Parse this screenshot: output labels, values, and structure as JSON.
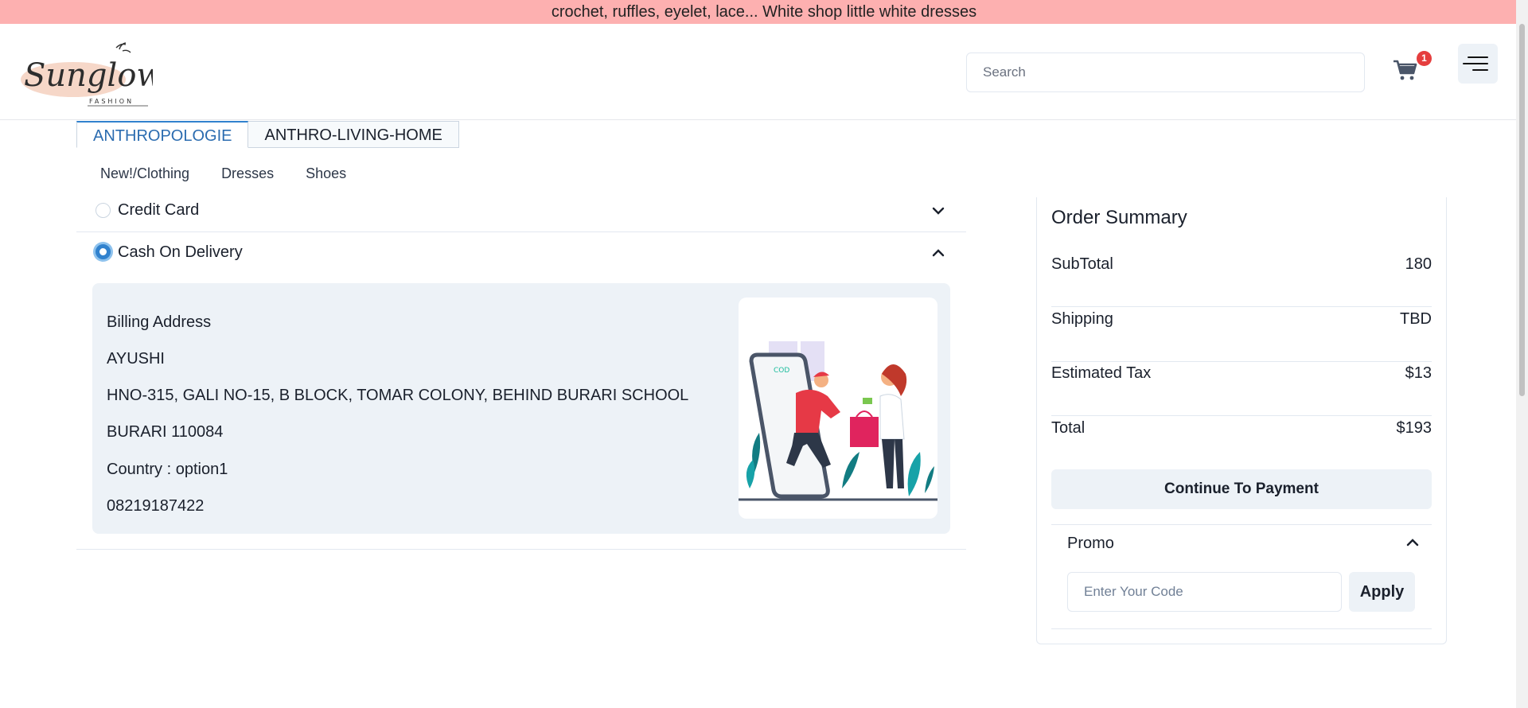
{
  "announcement": "crochet, ruffles, eyelet, lace... White shop little white dresses",
  "brand": {
    "name": "Sunglow",
    "tagline": "FASHION"
  },
  "search": {
    "placeholder": "Search"
  },
  "cart": {
    "count": "1"
  },
  "tabs": [
    {
      "label": "ANTHROPOLOGIE",
      "active": true
    },
    {
      "label": "ANTHRO-LIVING-HOME",
      "active": false
    }
  ],
  "subnav": [
    "New!/Clothing",
    "Dresses",
    "Shoes"
  ],
  "payment": {
    "credit_card_label": "Credit Card",
    "cod_label": "Cash On Delivery",
    "selected": "Cash On Delivery",
    "cod_image_text": "COD",
    "billing": {
      "heading": "Billing Address",
      "name": "AYUSHI",
      "street": "HNO-315, GALI NO-15, B BLOCK, TOMAR COLONY, BEHIND BURARI SCHOOL",
      "city": "BURARI 110084",
      "country": "Country : option1",
      "phone": "08219187422"
    }
  },
  "summary": {
    "title": "Order Summary",
    "rows": [
      {
        "label": "SubTotal",
        "value": "180"
      },
      {
        "label": "Shipping",
        "value": "TBD"
      },
      {
        "label": "Estimated Tax",
        "value": "$13"
      },
      {
        "label": "Total",
        "value": "$193"
      }
    ],
    "continue_label": "Continue To Payment",
    "promo_label": "Promo",
    "promo_placeholder": "Enter Your Code",
    "apply_label": "Apply"
  },
  "colors": {
    "announcement_bg": "#fdb0b0",
    "accent": "#3182ce",
    "badge": "#e53e3e",
    "panel_bg": "#edf2f7"
  }
}
